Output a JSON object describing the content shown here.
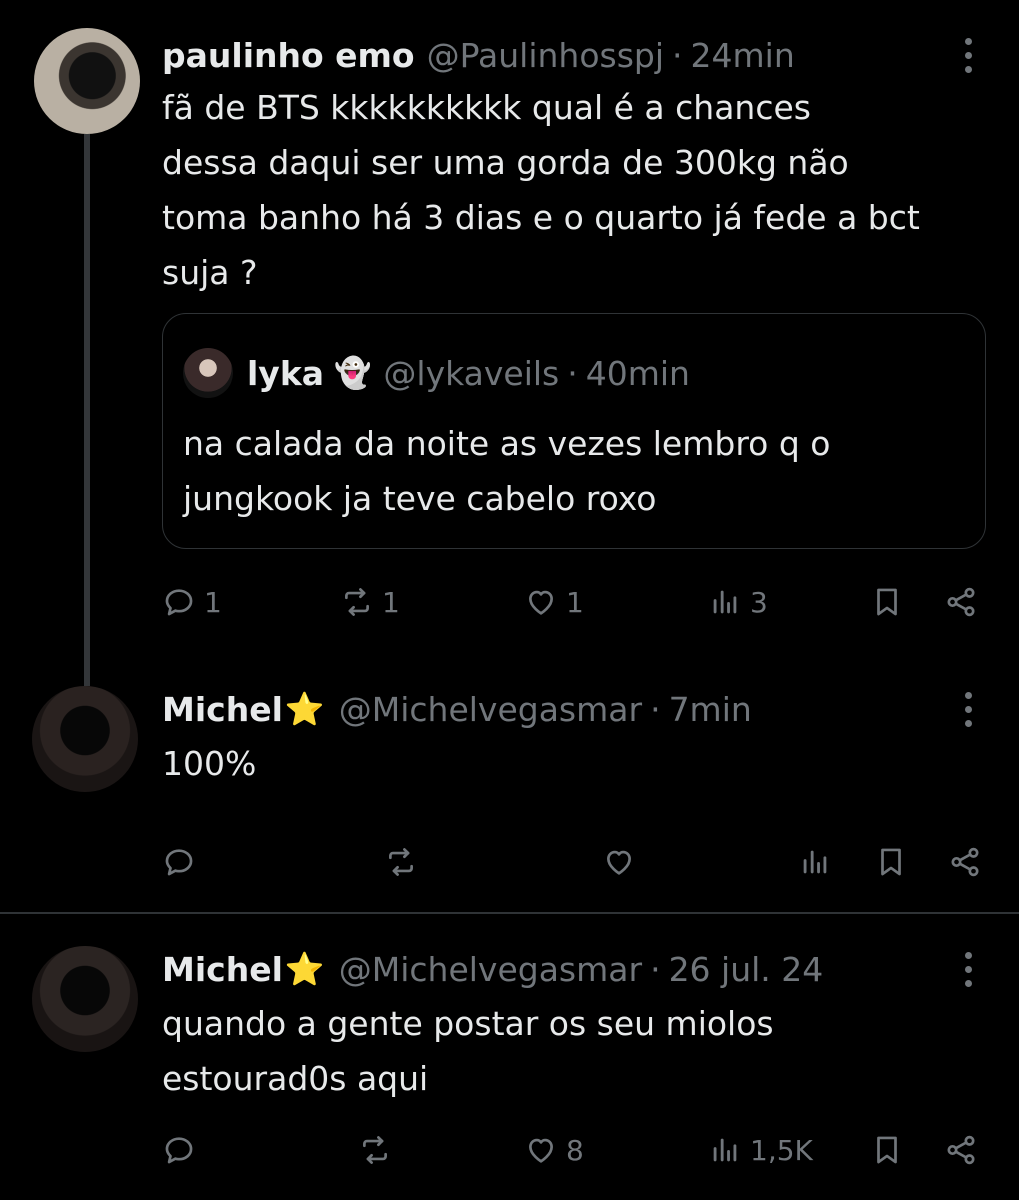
{
  "posts": [
    {
      "name": "paulinho emo",
      "handle": "@Paulinhosspj",
      "time": "24min",
      "lines": [
        "fã de BTS kkkkkkkkkk qual é a chances",
        "dessa daqui ser uma gorda de 300kg não",
        "toma banho há 3 dias e o quarto já fede a bct",
        "suja ?"
      ],
      "quote": {
        "name": "lyka",
        "emoji": "👻",
        "handle": "@lykaveils",
        "time": "40min",
        "lines": [
          "na calada da noite as vezes lembro q o",
          "jungkook ja teve cabelo roxo"
        ]
      },
      "counts": {
        "replies": "1",
        "reposts": "1",
        "likes": "1",
        "views": "3"
      }
    },
    {
      "name": "Michel",
      "star": "⭐",
      "handle": "@Michelvegasmar",
      "time": "7min",
      "lines": [
        "100%"
      ],
      "counts": {
        "replies": "",
        "reposts": "",
        "likes": "",
        "views": ""
      }
    },
    {
      "name": "Michel",
      "star": "⭐",
      "handle": "@Michelvegasmar",
      "time": "26 jul. 24",
      "lines": [
        "quando a gente postar os seu miolos",
        "estourad0s aqui"
      ],
      "counts": {
        "replies": "",
        "reposts": "",
        "likes": "8",
        "views": "1,5K"
      }
    }
  ],
  "icons": [
    "reply-icon",
    "repost-icon",
    "like-icon",
    "views-icon",
    "bookmark-icon",
    "share-icon",
    "more-icon"
  ],
  "colors": {
    "background": "#000000",
    "text": "#e7e9ea",
    "muted": "#71767b",
    "border": "#2f3336",
    "star": "#f5c518"
  }
}
